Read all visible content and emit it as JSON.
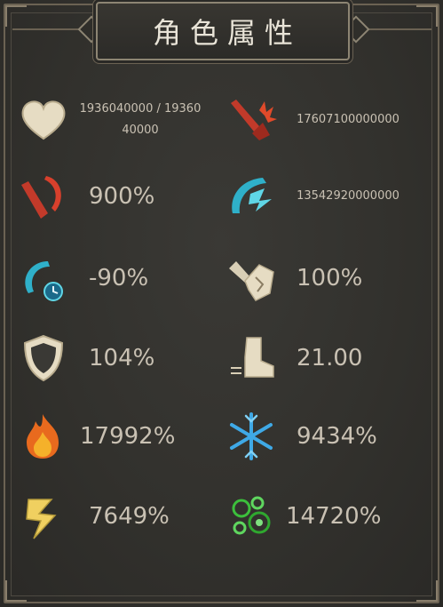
{
  "title": "角色属性",
  "stats": [
    {
      "icon": "heart-icon",
      "value": "1936040000 / 1936040000"
    },
    {
      "icon": "attack-slash-icon",
      "value": "17607100000000"
    },
    {
      "icon": "crit-rate-icon",
      "value": "900%"
    },
    {
      "icon": "crit-damage-icon",
      "value": "13542920000000"
    },
    {
      "icon": "cooldown-icon",
      "value": "-90%"
    },
    {
      "icon": "attack-speed-icon",
      "value": "100%"
    },
    {
      "icon": "shield-icon",
      "value": "104%"
    },
    {
      "icon": "boot-speed-icon",
      "value": "21.00"
    },
    {
      "icon": "fire-icon",
      "value": "17992%"
    },
    {
      "icon": "ice-snowflake-icon",
      "value": "9434%"
    },
    {
      "icon": "lightning-icon",
      "value": "7649%"
    },
    {
      "icon": "poison-icon",
      "value": "14720%"
    }
  ],
  "colors": {
    "background": "#32312d",
    "frame": "#8d8573",
    "text": "#c9c1b3",
    "title": "#e9e4d8"
  }
}
